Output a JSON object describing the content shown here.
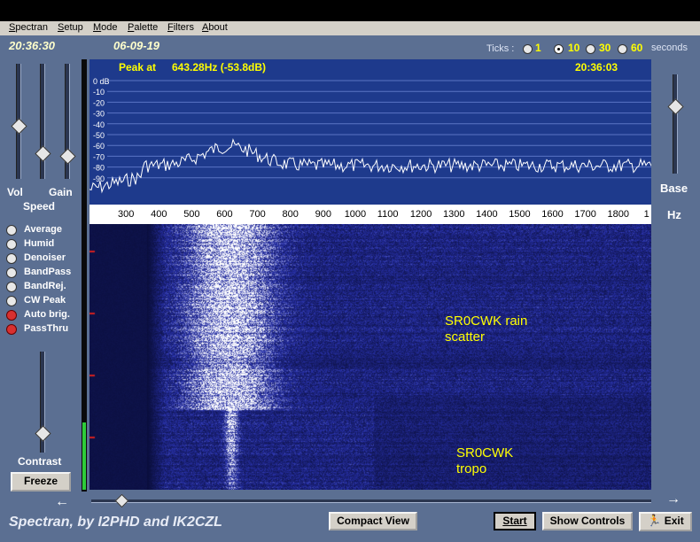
{
  "menu": [
    "Spectran",
    "Setup",
    "Mode",
    "Palette",
    "Filters",
    "About"
  ],
  "status": {
    "time": "20:36:30",
    "date": "06-09-19",
    "peak_label": "Peak at",
    "peak_value": "643.28Hz (-53.8dB)",
    "peak_time": "20:36:03"
  },
  "ticks": {
    "label": "Ticks :",
    "options": [
      "1",
      "10",
      "30",
      "60"
    ],
    "selected": "10",
    "unit": "seconds"
  },
  "sliders": {
    "vol_label": "Vol",
    "gain_label": "Gain",
    "speed_label": "Speed",
    "contrast_label": "Contrast",
    "base_label": "Base",
    "hz_label": "Hz"
  },
  "options": [
    {
      "label": "Average",
      "on": false
    },
    {
      "label": "Humid",
      "on": false
    },
    {
      "label": "Denoiser",
      "on": false
    },
    {
      "label": "BandPass",
      "on": false
    },
    {
      "label": "BandRej.",
      "on": false
    },
    {
      "label": "CW Peak",
      "on": false
    },
    {
      "label": "Auto brig.",
      "on": true
    },
    {
      "label": "PassThru",
      "on": true
    }
  ],
  "db_scale": [
    "0 dB",
    "-10",
    "-20",
    "-30",
    "-40",
    "-50",
    "-60",
    "-70",
    "-80",
    "-90"
  ],
  "freq_ticks": [
    "300",
    "400",
    "500",
    "600",
    "700",
    "800",
    "900",
    "1000",
    "1100",
    "1200",
    "1300",
    "1400",
    "1500",
    "1600",
    "1700",
    "1800",
    "1"
  ],
  "annotations": {
    "rain_line1": "SR0CWK rain",
    "rain_line2": "scatter",
    "tropo_line1": "SR0CWK",
    "tropo_line2": "tropo"
  },
  "buttons": {
    "freeze": "Freeze",
    "compact": "Compact View",
    "start": "Start",
    "show_controls": "Show Controls",
    "exit": "Exit"
  },
  "footer": "Spectran, by I2PHD and IK2CZL",
  "colors": {
    "panel": "#5b6f92",
    "spectrum_bg": "#1e3a8c",
    "text_yellow": "#ffff00",
    "waterfall_hot": "#ffffff",
    "waterfall_cold": "#0a1040"
  }
}
